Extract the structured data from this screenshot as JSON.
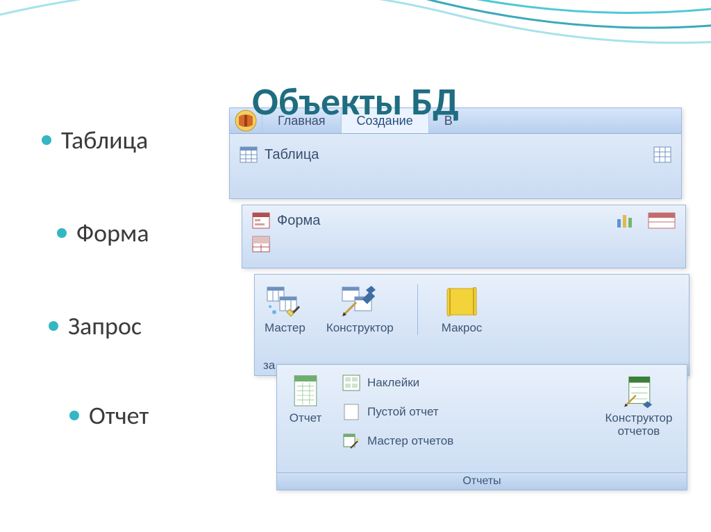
{
  "title": "Объекты БД",
  "bullets": {
    "b1": "Таблица",
    "b2": "Форма",
    "b3": "Запрос",
    "b4": "Отчет"
  },
  "tabs": {
    "home": "Главная",
    "create": "Создание",
    "partial": "В"
  },
  "ribbon": {
    "table": "Таблица",
    "form": "Форма",
    "query_wizard": "Мастер",
    "query_designer": "Конструктор",
    "macro": "Макрос",
    "za_partial": "за",
    "report": "Отчет",
    "labels": "Наклейки",
    "blank_report": "Пустой отчет",
    "report_wizard": "Мастер отчетов",
    "report_designer": "Конструктор отчетов",
    "reports_group": "Отчеты"
  }
}
